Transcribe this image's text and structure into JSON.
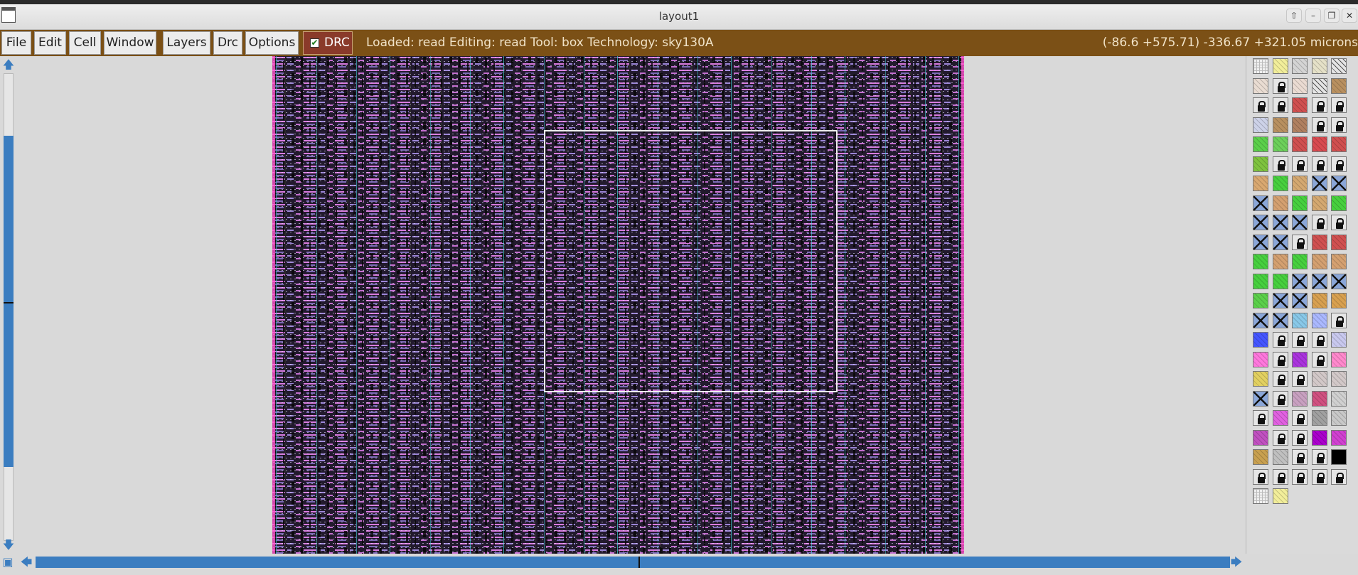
{
  "window": {
    "title": "layout1"
  },
  "menu": {
    "items": [
      "File",
      "Edit",
      "Cell",
      "Window",
      "Layers",
      "Drc",
      "Options"
    ],
    "drc_toggle": {
      "label": "DRC",
      "checked": true
    }
  },
  "status": {
    "text": "Loaded: read Editing: read Tool: box  Technology: sky130A",
    "coords": "(-86.6 +575.71) -336.67 +321.05 microns"
  },
  "colors": {
    "menubar": "#7b5016",
    "scroll_accent": "#3b7dc0",
    "layout_background": "#17131f",
    "selection_box": "#eeeeee"
  },
  "icons": {
    "close": "close-icon",
    "window_menu": "window-menu-icon",
    "scroll_up": "arrow-up-icon",
    "scroll_down": "arrow-down-icon",
    "scroll_left": "arrow-left-icon",
    "scroll_right": "arrow-right-icon",
    "zoom": "zoom-box-icon",
    "layer_lock": "lock-icon"
  },
  "palette": {
    "rows": [
      [
        "grid",
        "#f2ee9a",
        "#d4d4d4",
        "#e5e1c8",
        "diag"
      ],
      [
        "#e9dcd2",
        "lock",
        "#eadbd2",
        "diag",
        "#b89060"
      ],
      [
        "lock",
        "lock",
        "#d05050",
        "lock",
        "lock"
      ],
      [
        "#cdd2e8",
        "#b89060",
        "#b08060",
        "lock",
        "lock"
      ],
      [
        "#5bd04a",
        "#6cd05a",
        "#d05050",
        "#d84a50",
        "#d05050"
      ],
      [
        "#7ec33e",
        "lock",
        "lock",
        "lock",
        "lock"
      ],
      [
        "#d9a870",
        "#47d03e",
        "#d4a870",
        "cross",
        "cross"
      ],
      [
        "cross",
        "#d4a070",
        "#47d03e",
        "#d4a870",
        "#47d03e"
      ],
      [
        "cross",
        "cross",
        "cross",
        "lock",
        "lock"
      ],
      [
        "cross",
        "cross",
        "lock",
        "#d05050",
        "#d05050"
      ],
      [
        "#47d03e",
        "#d4a070",
        "#47d03e",
        "#d4a070",
        "#d4a070"
      ],
      [
        "#47d03e",
        "#47d03e",
        "cross",
        "cross",
        "cross"
      ],
      [
        "#5bd04a",
        "cross",
        "cross",
        "#d8a050",
        "#d8a050"
      ],
      [
        "cross",
        "cross",
        "#88c8e8",
        "#aab8ff",
        "lock"
      ],
      [
        "#4455ff",
        "lock",
        "lock",
        "lock",
        "#c8c8ee"
      ],
      [
        "#ff77dd",
        "lock",
        "#aa33dd",
        "lock",
        "#ff88cc"
      ],
      [
        "#e2d060",
        "lock",
        "lock",
        "#d2c8c8",
        "#d2c8c8"
      ],
      [
        "cross",
        "lock",
        "#c8a0c0",
        "#d05080",
        "#d0d0d0"
      ],
      [
        "lock",
        "#e060e0",
        "lock",
        "#a0a0a0",
        "#c8c8c8"
      ],
      [
        "#c050c0",
        "lock",
        "lock",
        "#aa00cc",
        "#d040d0"
      ],
      [
        "#c8a050",
        "#c0c0c0",
        "lock",
        "lock",
        "#000000"
      ],
      [
        "lock",
        "lock",
        "lock",
        "lock",
        "lock"
      ],
      [
        "grid",
        "#f2ee9a"
      ]
    ]
  }
}
